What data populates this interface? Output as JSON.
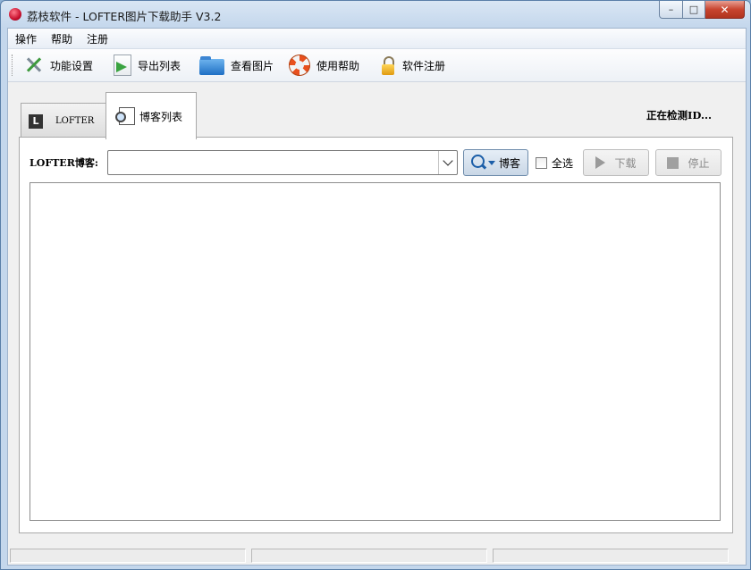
{
  "window": {
    "title": "荔枝软件 - LOFTER图片下载助手 V3.2",
    "caption": {
      "minimize": "–",
      "maximize": "□",
      "close": "✕"
    }
  },
  "menu": [
    "操作",
    "帮助",
    "注册"
  ],
  "toolbar": [
    {
      "label": "功能设置",
      "icon": "tools-icon"
    },
    {
      "label": "导出列表",
      "icon": "export-icon"
    },
    {
      "label": "查看图片",
      "icon": "folder-icon"
    },
    {
      "label": "使用帮助",
      "icon": "lifebuoy-icon"
    },
    {
      "label": "软件注册",
      "icon": "lock-icon"
    }
  ],
  "tabs": {
    "lofter": {
      "icon_letter": "L",
      "label": "LOFTER"
    },
    "blog_list": {
      "label": "博客列表"
    }
  },
  "status_top": "正在检测ID...",
  "form": {
    "blog_label": "LOFTER博客:",
    "blog_value": "",
    "blog_button": "博客",
    "select_all": "全选",
    "select_all_checked": false,
    "download": "下载",
    "stop": "停止"
  },
  "list_items": [],
  "statusbar": [
    "",
    "",
    ""
  ]
}
